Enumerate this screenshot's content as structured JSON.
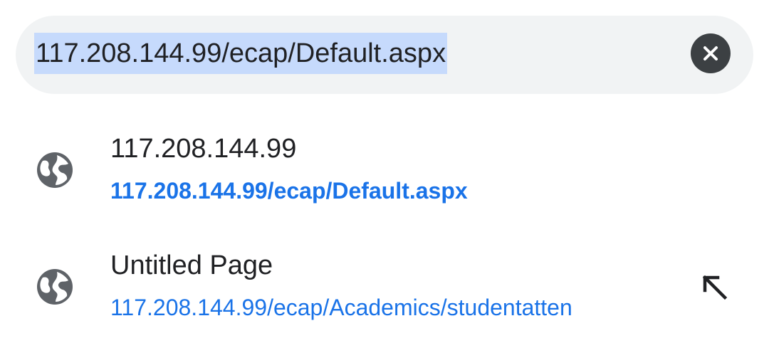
{
  "omnibox": {
    "text": "117.208.144.99/ecap/Default.aspx",
    "clear_icon": "close-circle-icon"
  },
  "suggestions": [
    {
      "title": "117.208.144.99",
      "url": "117.208.144.99/ecap/Default.aspx",
      "icon": "globe-icon"
    },
    {
      "title": "Untitled Page",
      "url": "117.208.144.99/ecap/Academics/studentatten",
      "icon": "globe-icon",
      "action_icon": "arrow-up-left-icon"
    }
  ],
  "colors": {
    "selection": "#c6dafc",
    "url_blue": "#1a73e8",
    "icon_gray": "#5f6368",
    "omnibox_bg": "#f1f3f4"
  }
}
